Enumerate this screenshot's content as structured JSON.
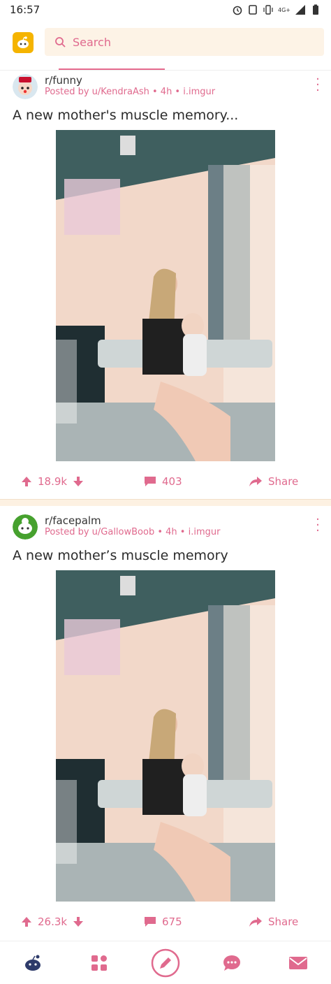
{
  "status_bar": {
    "time": "16:57",
    "network": "4G+"
  },
  "search": {
    "placeholder": "Search"
  },
  "posts": [
    {
      "subreddit": "r/funny",
      "meta": "Posted by u/KendraAsh • 4h • i.imgur",
      "title": "A new mother's muscle memory...",
      "votes": "18.9k",
      "comments": "403",
      "share": "Share"
    },
    {
      "subreddit": "r/facepalm",
      "meta": "Posted by u/GallowBoob • 4h • i.imgur",
      "title": "A new mother’s muscle memory",
      "votes": "26.3k",
      "comments": "675",
      "share": "Share"
    }
  ],
  "colors": {
    "accent": "#e06a8e",
    "search_bg": "#fdf3e6",
    "separator": "#fdf1e2",
    "logo_bg": "#f5b400"
  },
  "icons": {
    "status": [
      "alarm-icon",
      "sim-icon",
      "vibrate-icon",
      "signal-icon",
      "battery-icon"
    ],
    "nav": [
      "home-icon",
      "communities-icon",
      "create-post-icon",
      "chat-icon",
      "inbox-icon"
    ]
  }
}
